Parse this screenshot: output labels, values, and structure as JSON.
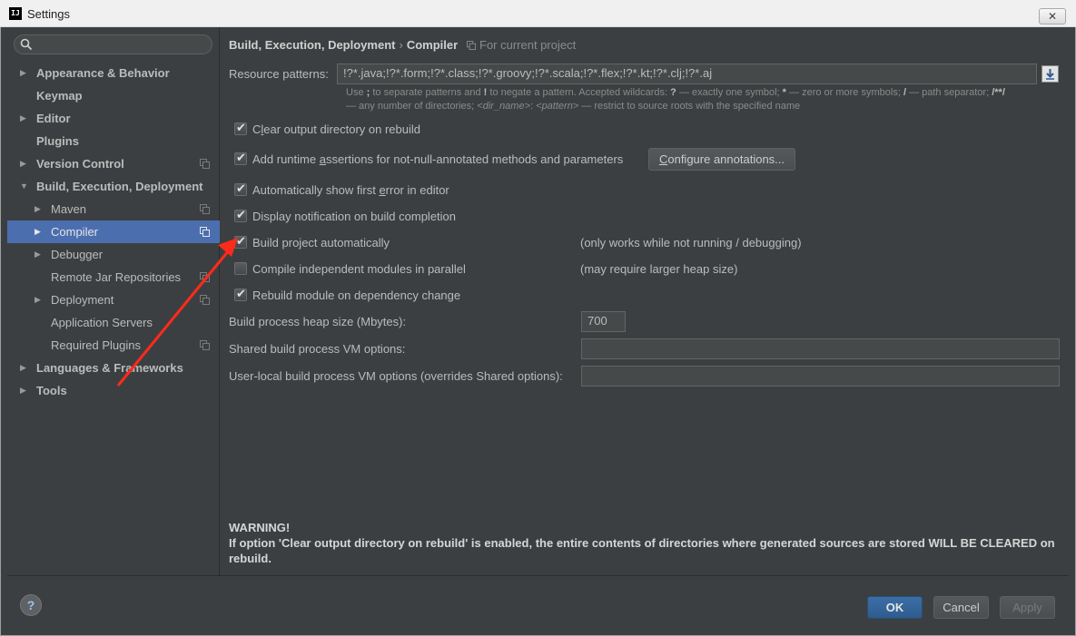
{
  "window": {
    "title": "Settings",
    "app_logo": "IJ"
  },
  "sidebar": {
    "search": {
      "value": "",
      "placeholder": ""
    },
    "items": [
      {
        "label": "Appearance & Behavior"
      },
      {
        "label": "Keymap"
      },
      {
        "label": "Editor"
      },
      {
        "label": "Plugins"
      },
      {
        "label": "Version Control"
      },
      {
        "label": "Build, Execution, Deployment"
      },
      {
        "label": "Maven"
      },
      {
        "label": "Compiler"
      },
      {
        "label": "Debugger"
      },
      {
        "label": "Remote Jar Repositories"
      },
      {
        "label": "Deployment"
      },
      {
        "label": "Application Servers"
      },
      {
        "label": "Required Plugins"
      },
      {
        "label": "Languages & Frameworks"
      },
      {
        "label": "Tools"
      }
    ],
    "selected": "Compiler"
  },
  "breadcrumb": {
    "parent": "Build, Execution, Deployment",
    "separator": "›",
    "current": "Compiler",
    "scope": "For current project"
  },
  "resource_patterns": {
    "label": "Resource patterns:",
    "value": "!?*.java;!?*.form;!?*.class;!?*.groovy;!?*.scala;!?*.flex;!?*.kt;!?*.clj;!?*.aj",
    "hint_line1": {
      "t1": "Use",
      "k1": ";",
      "t2": "to separate patterns and",
      "k2": "!",
      "t3": "to negate a pattern. Accepted wildcards:",
      "k3": "?",
      "t4": "— exactly one symbol;",
      "k4": "*",
      "t5": "— zero or more symbols;",
      "k5": "/",
      "t6": "— path separator;",
      "k6": "/**/"
    },
    "hint_line2": {
      "t1": "— any number of directories;",
      "i1": "<dir_name>",
      "t2": ":",
      "i2": "<pattern>",
      "t3": "— restrict to source roots with the specified name"
    }
  },
  "options": {
    "clear_output": {
      "checked": true,
      "pre": "C",
      "mnemonic": "l",
      "post": "ear output directory on rebuild"
    },
    "runtime_assertions": {
      "checked": true,
      "pre": "Add runtime ",
      "mnemonic": "a",
      "post": "ssertions for not-null-annotated methods and parameters"
    },
    "configure_annotations": {
      "pre": "",
      "mnemonic": "C",
      "post": "onfigure annotations..."
    },
    "show_first_error": {
      "checked": true,
      "pre": "Automatically show first ",
      "mnemonic": "e",
      "post": "rror in editor"
    },
    "display_notification": {
      "checked": true,
      "label": "Display notification on build completion"
    },
    "build_automatically": {
      "checked": true,
      "label": "Build project automatically",
      "note": "(only works while not running / debugging)"
    },
    "compile_parallel": {
      "checked": false,
      "label": "Compile independent modules in parallel",
      "note": "(may require larger heap size)"
    },
    "rebuild_on_dependency": {
      "checked": true,
      "label": "Rebuild module on dependency change"
    }
  },
  "heap_size": {
    "label": "Build process heap size (Mbytes):",
    "value": "700"
  },
  "shared_vm": {
    "label": "Shared build process VM options:",
    "value": ""
  },
  "user_vm": {
    "label": "User-local build process VM options (overrides Shared options):",
    "value": ""
  },
  "warning": {
    "title": "WARNING!",
    "text": "If option 'Clear output directory on rebuild' is enabled, the entire contents of directories where generated sources are stored WILL BE CLEARED on rebuild."
  },
  "buttons": {
    "ok": "OK",
    "cancel": "Cancel",
    "apply": "Apply",
    "help": "?"
  },
  "colors": {
    "selection": "#4b6eaf",
    "background": "#3c3f41",
    "annotation_arrow": "#ff2a1a"
  },
  "checkmark": "✔"
}
